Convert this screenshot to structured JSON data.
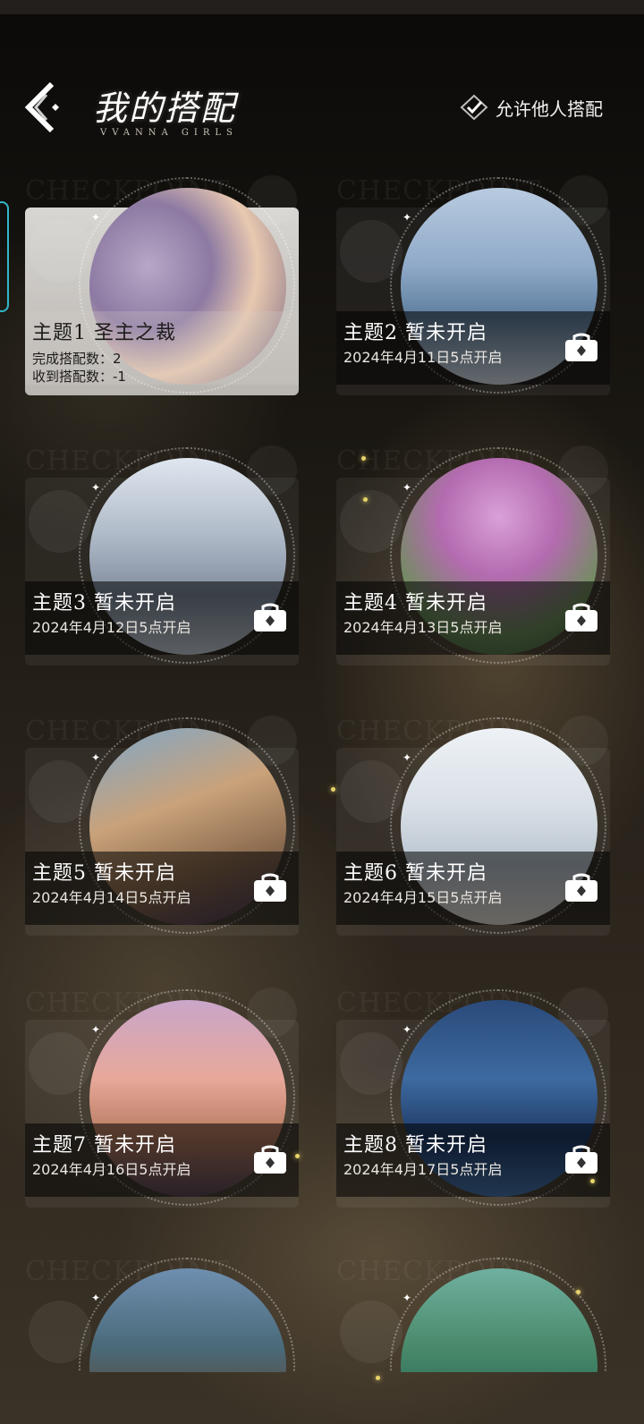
{
  "header": {
    "title": "我的搭配",
    "subtitle": "VVANNA GIRLS",
    "allow_label": "允许他人搭配",
    "allow_checked": true
  },
  "watermark": "CHECKPOINT",
  "cards": [
    {
      "theme": "主题1 圣主之裁",
      "state": "open",
      "stat_done": "完成搭配数：2",
      "stat_received": "收到搭配数：-1"
    },
    {
      "theme": "主题2 暂未开启",
      "state": "locked",
      "date": "2024年4月11日5点开启"
    },
    {
      "theme": "主题3 暂未开启",
      "state": "locked",
      "date": "2024年4月12日5点开启"
    },
    {
      "theme": "主题4 暂未开启",
      "state": "locked",
      "date": "2024年4月13日5点开启"
    },
    {
      "theme": "主题5 暂未开启",
      "state": "locked",
      "date": "2024年4月14日5点开启"
    },
    {
      "theme": "主题6 暂未开启",
      "state": "locked",
      "date": "2024年4月15日5点开启"
    },
    {
      "theme": "主题7 暂未开启",
      "state": "locked",
      "date": "2024年4月16日5点开启"
    },
    {
      "theme": "主题8 暂未开启",
      "state": "locked",
      "date": "2024年4月17日5点开启"
    }
  ],
  "icons": {
    "back": "chevron-left-icon",
    "check": "checkbox-check-icon",
    "lock": "lock-icon"
  }
}
